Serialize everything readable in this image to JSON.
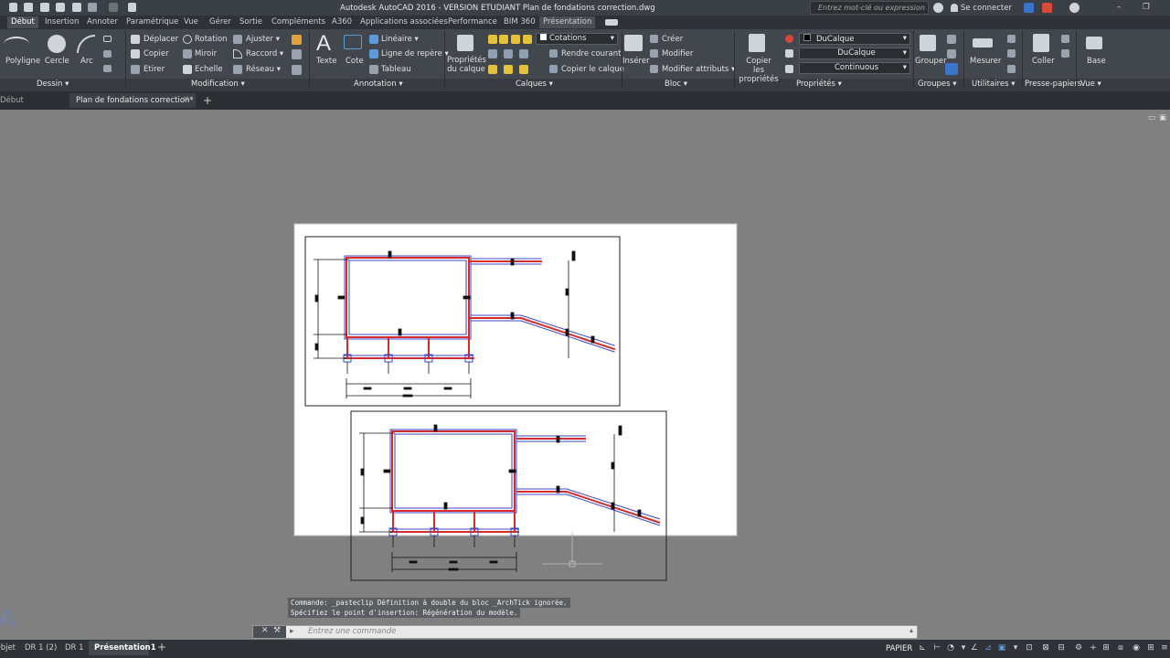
{
  "titlebar": {
    "title": "Autodesk AutoCAD 2016 - VERSION ETUDIANT    Plan de fondations correction.dwg",
    "search_placeholder": "Entrez mot-clé ou expression",
    "signin": "Se connecter"
  },
  "ribbon_tabs": [
    "Début",
    "Insertion",
    "Annoter",
    "Paramétrique",
    "Vue",
    "Gérer",
    "Sortie",
    "Compléments",
    "A360",
    "Applications associées",
    "Performance",
    "BIM 360",
    "Présentation"
  ],
  "panels": {
    "dessin": {
      "label": "Dessin ▾",
      "polyligne": "Polyligne",
      "cercle": "Cercle",
      "arc": "Arc"
    },
    "modification": {
      "label": "Modification ▾",
      "deplacer": "Déplacer",
      "rotation": "Rotation",
      "ajuster": "Ajuster ▾",
      "copier": "Copier",
      "miroir": "Miroir",
      "raccord": "Raccord ▾",
      "etirer": "Etirer",
      "echelle": "Echelle",
      "reseau": "Réseau ▾"
    },
    "annotation": {
      "label": "Annotation ▾",
      "texte": "Texte",
      "cote": "Cote",
      "lineaire": "Linéaire ▾",
      "ligne_repere": "Ligne de repère ▾",
      "tableau": "Tableau"
    },
    "calques": {
      "label": "Calques ▾",
      "proprietes_1": "Propriétés",
      "proprietes_2": "du calque",
      "layer_current": "Cotations",
      "rendre_courant": "Rendre courant",
      "copier_calque": "Copier le calque"
    },
    "bloc": {
      "label": "Bloc ▾",
      "inserer": "Insérer",
      "creer": "Créer",
      "modifier": "Modifier",
      "modifier_attributs": "Modifier attributs ▾"
    },
    "proprietes": {
      "label": "Propriétés ▾",
      "copier_1": "Copier",
      "copier_2": "les propriétés",
      "color": "DuCalque",
      "lineweight": "DuCalque",
      "linetype": "Continuous"
    },
    "groupes": {
      "label": "Groupes ▾",
      "grouper": "Grouper"
    },
    "utilitaires": {
      "label": "Utilitaires ▾",
      "mesurer": "Mesurer"
    },
    "presse": {
      "label": "Presse-papiers",
      "coller": "Coller"
    },
    "vue": {
      "label": "Vue ▾",
      "base": "Base"
    }
  },
  "doc_tabs": [
    "Début",
    "Plan de fondations correction*"
  ],
  "command_history": [
    "Commande: _pasteclip Définition à double du bloc _ArchTick  ignorée.",
    "Spécifiez le point d'insertion: Régénération du modèle."
  ],
  "command_placeholder": "Entrez une commande",
  "layout_tabs": [
    "Objet",
    "DR 1 (2)",
    "DR 1",
    "Présentation1"
  ],
  "status": {
    "papier": "PAPIER"
  },
  "colors": {
    "dim_red": "#d42b2b",
    "dim_blue": "#3a44c8",
    "ribbon": "#42464d",
    "active_tab": "#4a4e55"
  }
}
